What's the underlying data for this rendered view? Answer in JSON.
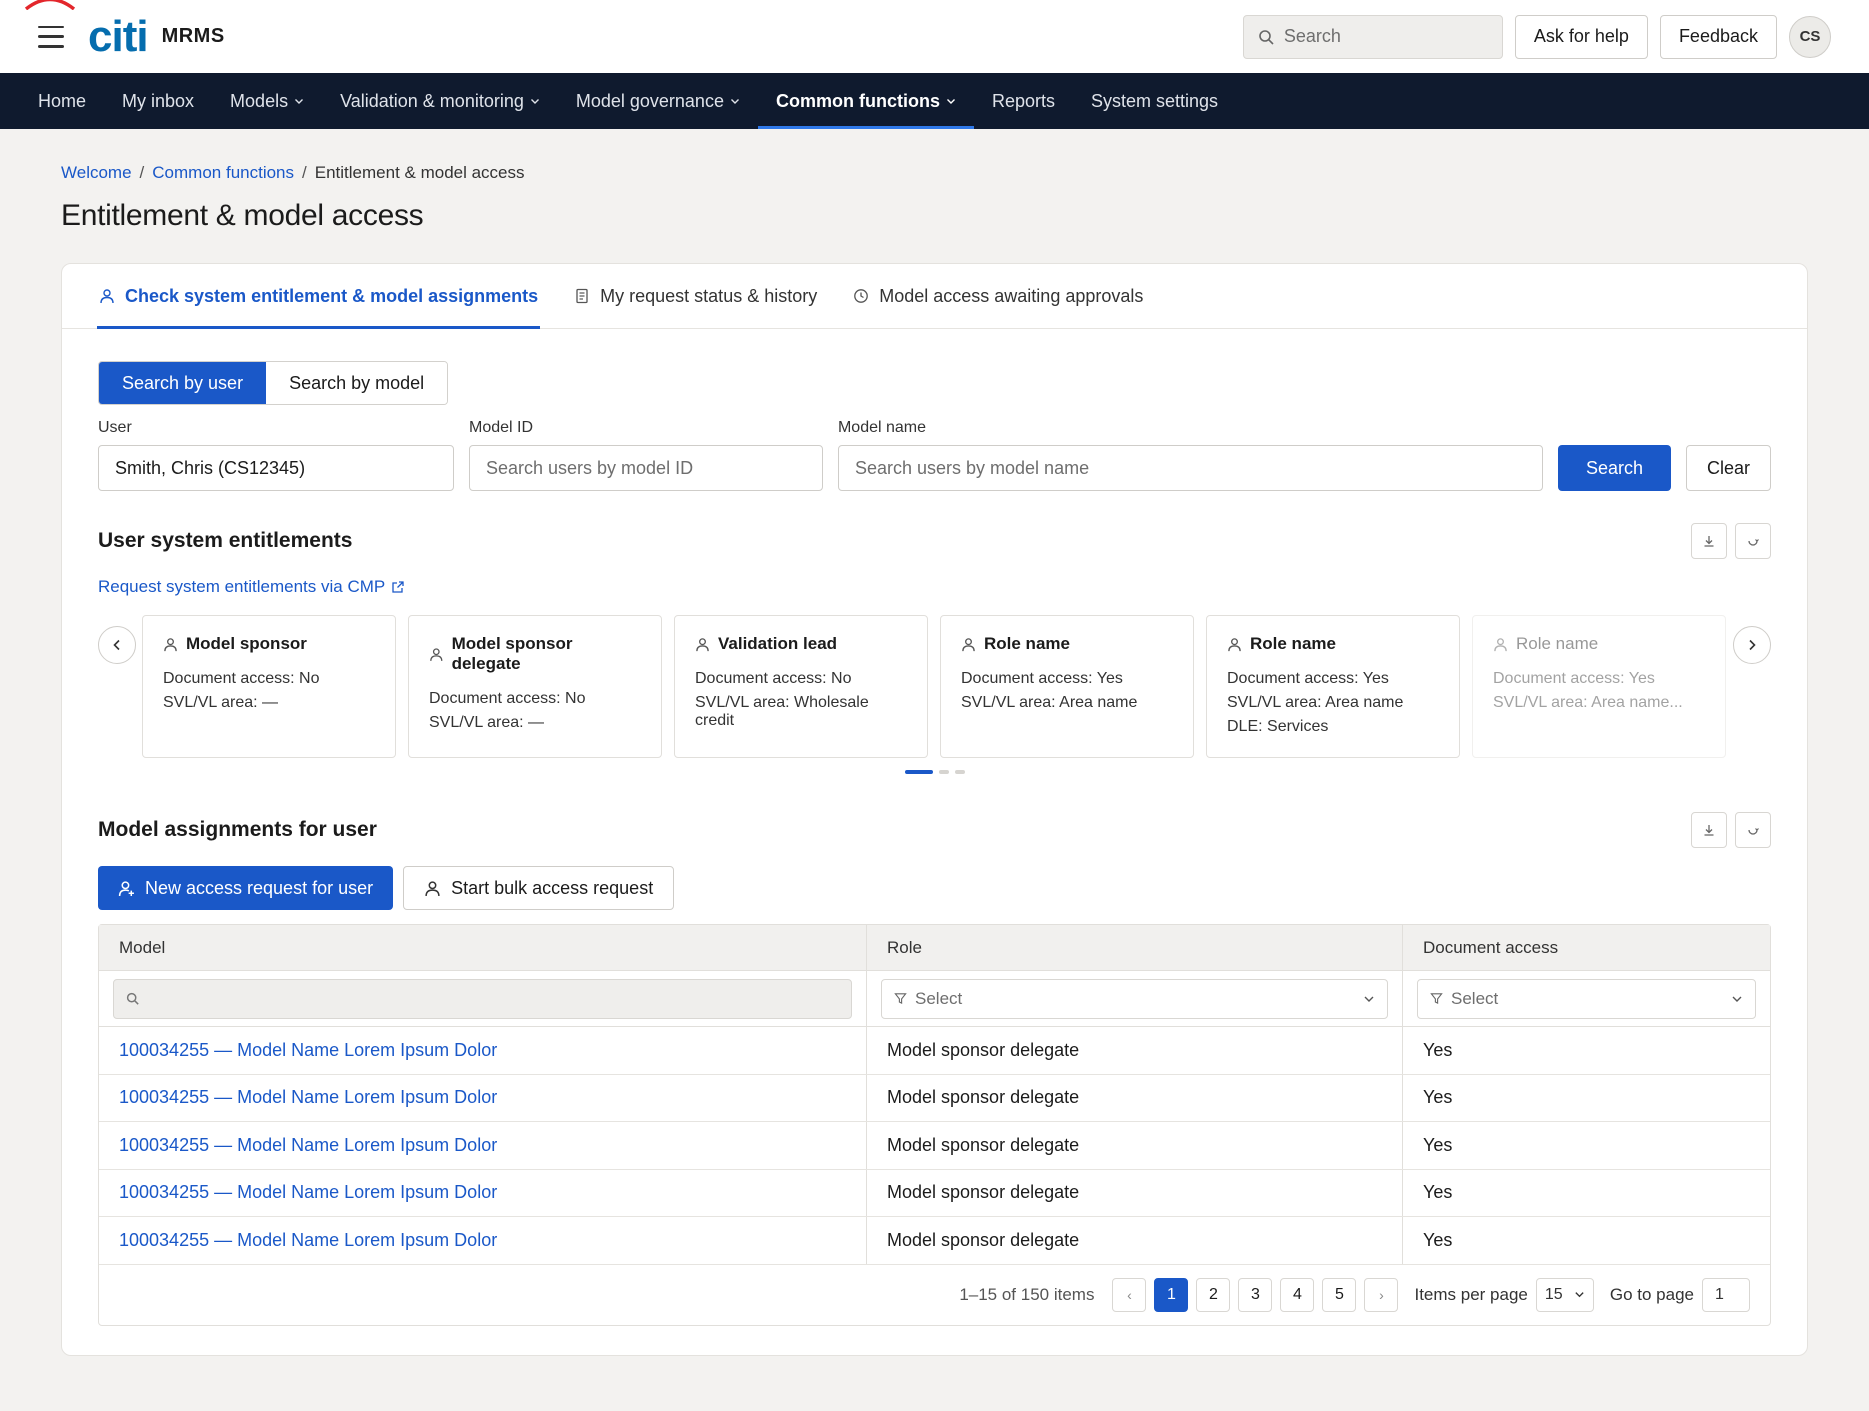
{
  "app": {
    "logo": "citi",
    "name": "MRMS"
  },
  "topbar": {
    "search_placeholder": "Search",
    "help_label": "Ask for help",
    "feedback_label": "Feedback",
    "avatar_initials": "CS"
  },
  "nav": {
    "items": [
      {
        "label": "Home"
      },
      {
        "label": "My inbox"
      },
      {
        "label": "Models"
      },
      {
        "label": "Validation & monitoring"
      },
      {
        "label": "Model governance"
      },
      {
        "label": "Common functions"
      },
      {
        "label": "Reports"
      },
      {
        "label": "System settings"
      }
    ],
    "active": "Common functions"
  },
  "breadcrumb": [
    "Welcome",
    "Common functions",
    "Entitlement & model access"
  ],
  "page_title": "Entitlement & model access",
  "tabs": [
    {
      "label": "Check system entitlement & model assignments",
      "icon": "user-icon"
    },
    {
      "label": "My request status & history",
      "icon": "document-icon"
    },
    {
      "label": "Model access awaiting approvals",
      "icon": "clock-icon"
    }
  ],
  "search_mode": {
    "by_user": "Search by user",
    "by_model": "Search by model"
  },
  "form": {
    "user_label": "User",
    "user_value": "Smith, Chris (CS12345)",
    "model_id_label": "Model ID",
    "model_id_placeholder": "Search users by model ID",
    "model_name_label": "Model name",
    "model_name_placeholder": "Search users by model name",
    "search_button": "Search",
    "clear_button": "Clear"
  },
  "entitlements": {
    "title": "User system entitlements",
    "link": "Request system entitlements via CMP",
    "cards": [
      {
        "name": "Model sponsor",
        "lines": [
          "Document access: No",
          "SVL/VL area: —"
        ]
      },
      {
        "name": "Model sponsor delegate",
        "lines": [
          "Document access: No",
          "SVL/VL area: —"
        ]
      },
      {
        "name": "Validation lead",
        "lines": [
          "Document access: No",
          "SVL/VL area: Wholesale credit"
        ]
      },
      {
        "name": "Role name",
        "lines": [
          "Document access: Yes",
          "SVL/VL area: Area name"
        ]
      },
      {
        "name": "Role name",
        "lines": [
          "Document access: Yes",
          "SVL/VL area: Area name",
          "DLE: Services"
        ]
      },
      {
        "name": "Role name",
        "lines": [
          "Document access: Yes",
          "SVL/VL area: Area name..."
        ]
      }
    ],
    "carousel_page": 1,
    "carousel_pages": 3
  },
  "assignments": {
    "title": "Model assignments for user",
    "new_request_button": "New access request for user",
    "bulk_request_button": "Start bulk access request",
    "columns": [
      "Model",
      "Role",
      "Document access"
    ],
    "role_filter_placeholder": "Select",
    "doc_filter_placeholder": "Select",
    "rows": [
      {
        "model": "100034255 — Model Name Lorem Ipsum Dolor",
        "role": "Model sponsor delegate",
        "doc": "Yes"
      },
      {
        "model": "100034255 — Model Name Lorem Ipsum Dolor",
        "role": "Model sponsor delegate",
        "doc": "Yes"
      },
      {
        "model": "100034255 — Model Name Lorem Ipsum Dolor",
        "role": "Model sponsor delegate",
        "doc": "Yes"
      },
      {
        "model": "100034255 — Model Name Lorem Ipsum Dolor",
        "role": "Model sponsor delegate",
        "doc": "Yes"
      },
      {
        "model": "100034255 — Model Name Lorem Ipsum Dolor",
        "role": "Model sponsor delegate",
        "doc": "Yes"
      }
    ]
  },
  "pagination": {
    "summary": "1–15 of 150 items",
    "prev": "‹",
    "next": "›",
    "pages": [
      "1",
      "2",
      "3",
      "4",
      "5"
    ],
    "current": "1",
    "items_per_page_label": "Items per page",
    "items_per_page": "15",
    "go_to_label": "Go to page",
    "go_to_value": "1"
  },
  "colors": {
    "primary": "#1a58c8",
    "nav_bg": "#0f1a2e",
    "brand": "#056dae",
    "brand_arc": "#e3262b"
  }
}
